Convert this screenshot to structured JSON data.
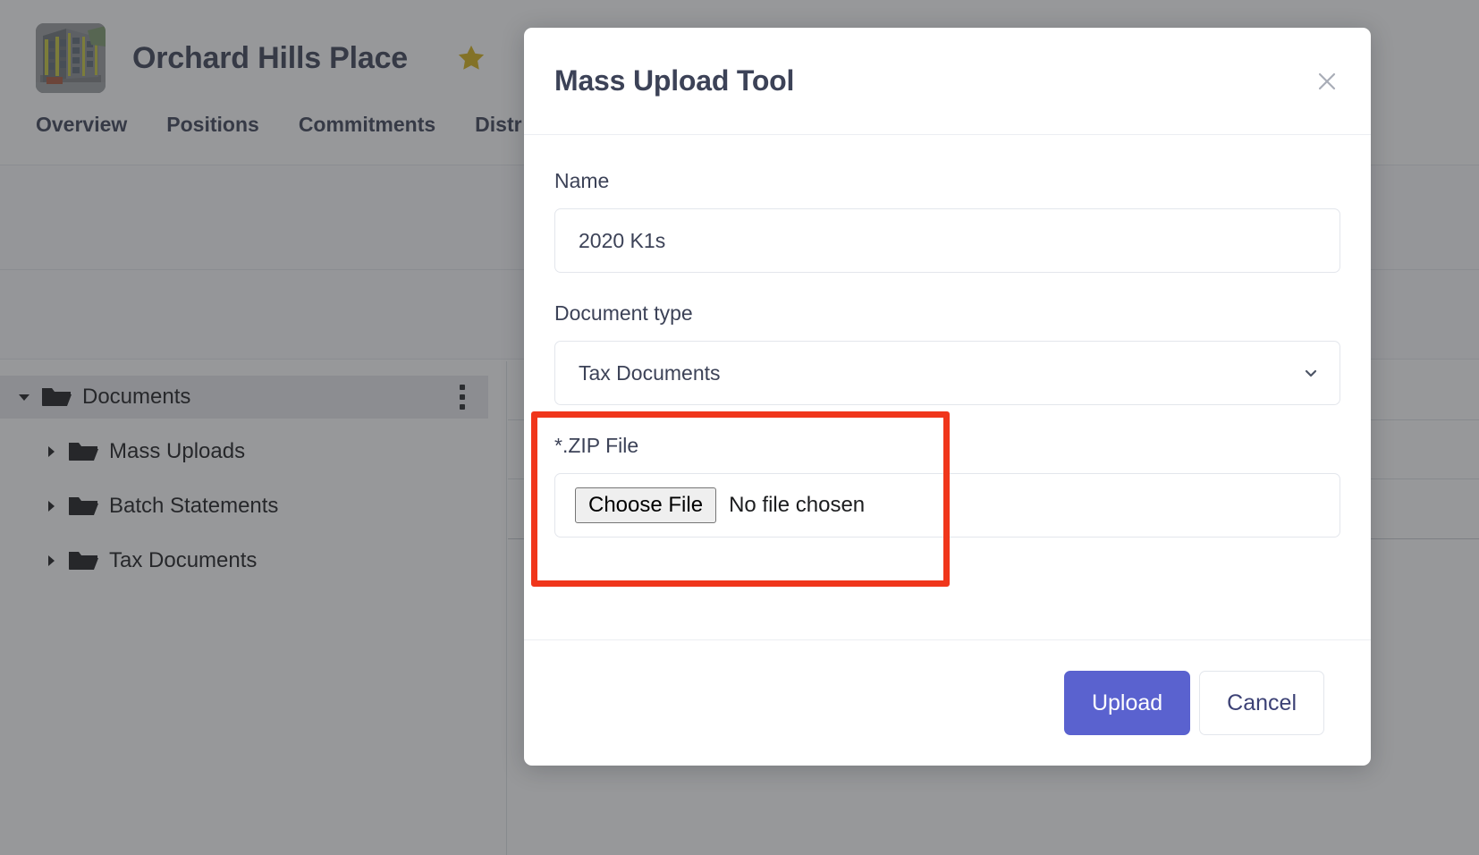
{
  "page": {
    "property": {
      "title": "Orchard Hills Place",
      "thumbnail_alt": "building-photo",
      "favorite_icon": "star-icon"
    },
    "tabs": [
      {
        "label": "Overview"
      },
      {
        "label": "Positions"
      },
      {
        "label": "Commitments"
      },
      {
        "label": "Distr"
      }
    ],
    "tree": [
      {
        "label": "Documents",
        "level": 0,
        "expanded": true,
        "selected": true,
        "has_menu": true
      },
      {
        "label": "Mass Uploads",
        "level": 1,
        "expanded": false,
        "selected": false,
        "has_menu": false
      },
      {
        "label": "Batch Statements",
        "level": 1,
        "expanded": false,
        "selected": false,
        "has_menu": false
      },
      {
        "label": "Tax Documents",
        "level": 1,
        "expanded": false,
        "selected": false,
        "has_menu": false
      }
    ]
  },
  "modal": {
    "title": "Mass Upload Tool",
    "close_icon": "close-icon",
    "fields": {
      "name": {
        "label": "Name",
        "value": "2020 K1s",
        "placeholder": "Name"
      },
      "document_type": {
        "label": "Document type",
        "value": "Tax Documents",
        "chevron_icon": "chevron-down-icon"
      },
      "zip_file": {
        "label": "*.ZIP File",
        "choose_button_label": "Choose File",
        "status_text": "No file chosen",
        "highlighted": true
      }
    },
    "footer": {
      "upload_label": "Upload",
      "cancel_label": "Cancel"
    }
  },
  "colors": {
    "primary_button": "#5a62cf",
    "annotation_highlight": "#f0361b",
    "text_dark": "#3c4257",
    "star": "#d6b319",
    "overlay": "rgba(48,50,54,0.5)"
  }
}
